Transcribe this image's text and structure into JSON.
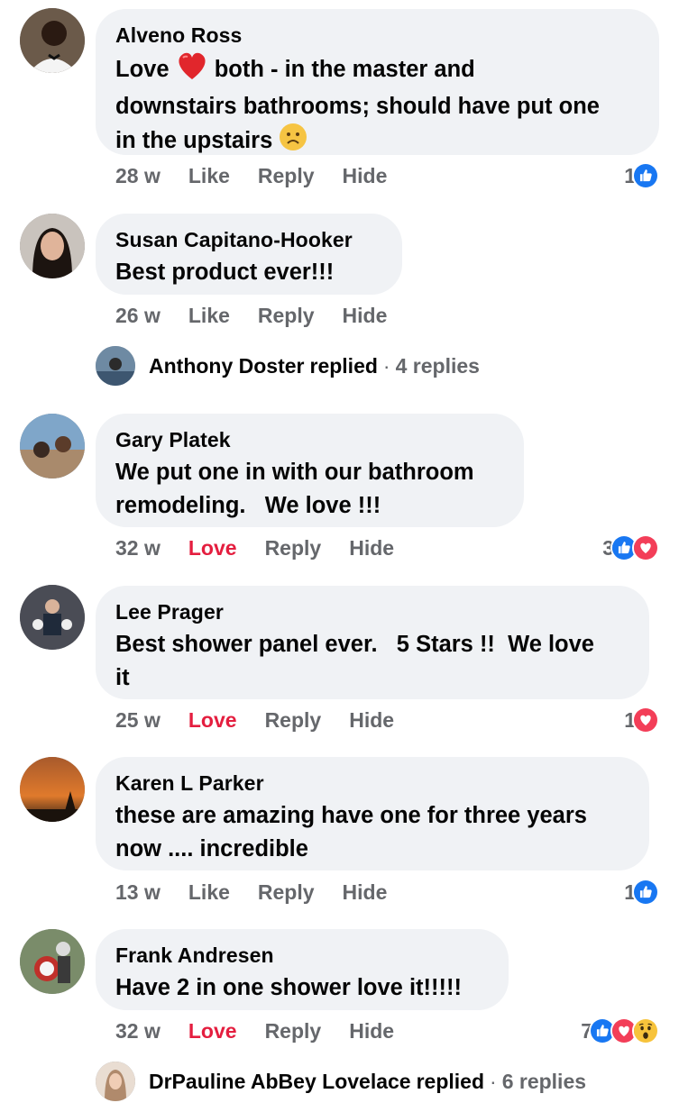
{
  "comments": [
    {
      "author": "Alveno Ross",
      "text_part1": "Love",
      "text_part2": "both - in the master and",
      "text_line2": "downstairs bathrooms; should have put one",
      "text_line3": "in the upstairs",
      "time": "28 w",
      "like_label": "Like",
      "reply_label": "Reply",
      "hide_label": "Hide",
      "reaction_count": "1",
      "reactions": [
        "like-icon"
      ]
    },
    {
      "author": "Susan Capitano-Hooker",
      "text": "Best product ever!!!",
      "time": "26 w",
      "like_label": "Like",
      "reply_label": "Reply",
      "hide_label": "Hide"
    },
    {
      "author": "Gary Platek",
      "text_line1": "We put one in with our bathroom",
      "text_line2": "remodeling.   We love !!!",
      "time": "32 w",
      "like_label": "Love",
      "reply_label": "Reply",
      "hide_label": "Hide",
      "reaction_count": "3",
      "reactions": [
        "like-icon",
        "love-icon"
      ]
    },
    {
      "author": "Lee Prager",
      "text_line1": "Best shower panel ever.   5 Stars !!  We love",
      "text_line2": "it",
      "time": "25 w",
      "like_label": "Love",
      "reply_label": "Reply",
      "hide_label": "Hide",
      "reaction_count": "1",
      "reactions": [
        "love-icon"
      ]
    },
    {
      "author": "Karen L Parker",
      "text_line1": "these are amazing have one for three years",
      "text_line2": "now .... incredible",
      "time": "13 w",
      "like_label": "Like",
      "reply_label": "Reply",
      "hide_label": "Hide",
      "reaction_count": "1",
      "reactions": [
        "like-icon"
      ]
    },
    {
      "author": "Frank Andresen",
      "text": "Have 2 in one shower love it!!!!!",
      "time": "32 w",
      "like_label": "Love",
      "reply_label": "Reply",
      "hide_label": "Hide",
      "reaction_count": "7",
      "reactions": [
        "like-icon",
        "love-icon",
        "wow-icon"
      ]
    }
  ],
  "replies": [
    {
      "name": "Anthony Doster",
      "verb": "replied",
      "separator": "·",
      "count": "4 replies"
    },
    {
      "name": "DrPauline AbBey Lovelace",
      "verb": "replied",
      "separator": "·",
      "count": "6 replies"
    }
  ],
  "colors": {
    "bubble": "#f0f2f5",
    "meta": "#65676b",
    "love": "#e41e3f",
    "like_blue": "#1877f2"
  }
}
